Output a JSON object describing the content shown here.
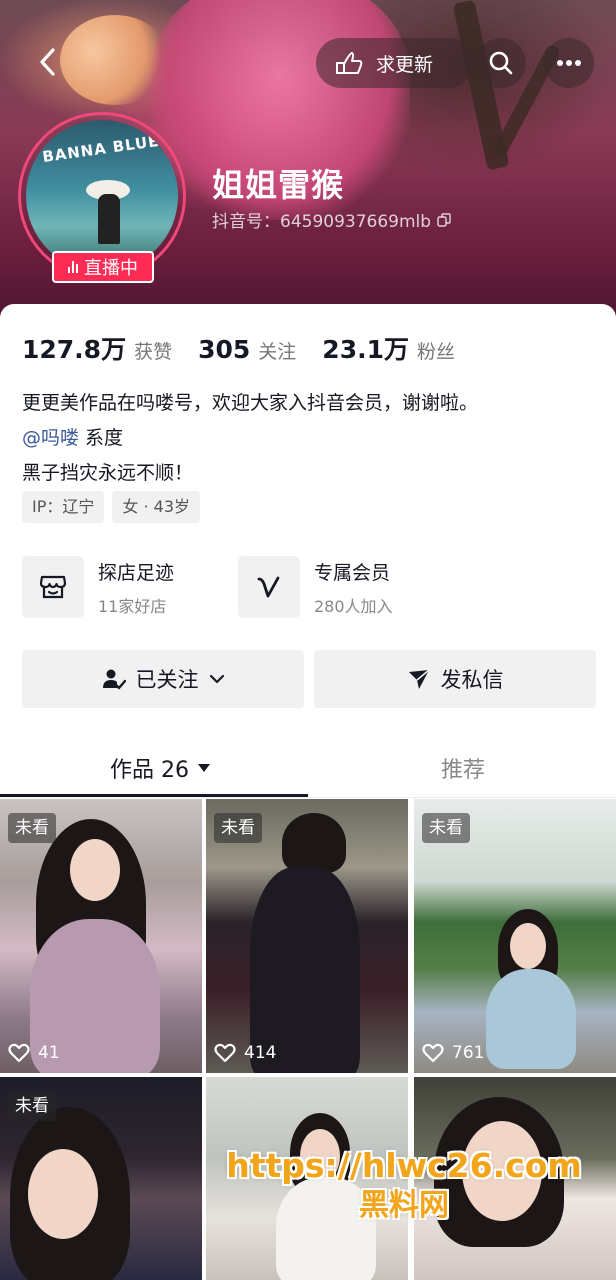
{
  "header": {
    "update_label": "求更新",
    "nickname": "姐姐雷猴",
    "douyin_id": "抖音号：64590937669mlb",
    "live_label": "直播中",
    "avatar_sign": "BANNA BLUE"
  },
  "stats": [
    {
      "num": "127.8万",
      "label": "获赞"
    },
    {
      "num": "305",
      "label": "关注"
    },
    {
      "num": "23.1万",
      "label": "粉丝"
    }
  ],
  "bio": {
    "line1": "更更美作品在吗喽号，欢迎大家入抖音会员，谢谢啦。",
    "mention": "@吗喽",
    "mention_suffix": " 系度",
    "line3": "黑子挡灾永远不顺！"
  },
  "tags": [
    "IP：辽宁",
    "女 · 43岁"
  ],
  "entries": [
    {
      "title": "探店足迹",
      "sub": "11家好店",
      "icon": "shop-icon"
    },
    {
      "title": "专属会员",
      "sub": "280人加入",
      "icon": "v-icon"
    }
  ],
  "actions": {
    "follow_label": "已关注",
    "message_label": "发私信"
  },
  "tabs": {
    "works_label": "作品 26",
    "recommend_label": "推荐"
  },
  "videos": [
    {
      "badge": "未看",
      "likes": "41"
    },
    {
      "badge": "未看",
      "likes": "414"
    },
    {
      "badge": "未看",
      "likes": "761"
    },
    {
      "badge": "未看",
      "likes": ""
    },
    {
      "badge": "",
      "likes": ""
    },
    {
      "badge": "",
      "likes": ""
    }
  ],
  "watermark": {
    "line1": "https://hlwc26.com",
    "line2": "黑料网"
  },
  "colors": {
    "accent": "#fe2c55",
    "mention": "#3b5998",
    "watermark": "#f2a51a"
  }
}
